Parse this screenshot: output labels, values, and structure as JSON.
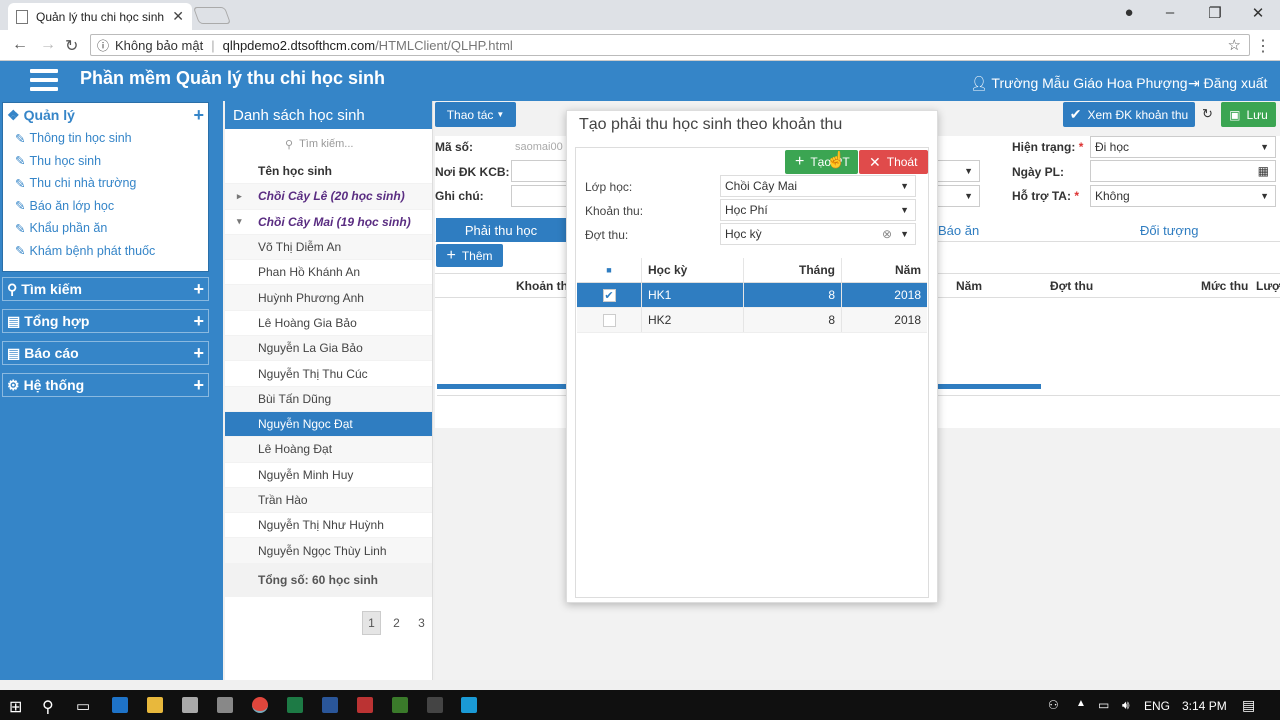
{
  "browser": {
    "tab_title": "Quản lý thu chi học sinh",
    "security_label": "Không bảo mật",
    "url_host": "qlhpdemo2.dtsofthcm.com",
    "url_path": "/HTMLClient/QLHP.html"
  },
  "app": {
    "title": "Phần mềm Quản lý thu chi học sinh",
    "school": "Trường Mẫu Giáo Hoa Phượng",
    "logout": "Đăng xuất"
  },
  "sidebar": {
    "section_manage": "Quản lý",
    "manage_items": [
      "Thông tin học sinh",
      "Thu học sinh",
      "Thu chi nhà trường",
      "Báo ăn lớp học",
      "Khẩu phần ăn",
      "Khám bệnh phát thuốc"
    ],
    "section_search": "Tìm kiếm",
    "section_summary": "Tổng hợp",
    "section_report": "Báo cáo",
    "section_system": "Hệ thống"
  },
  "students": {
    "title": "Danh sách học sinh",
    "search_placeholder": "Tìm kiếm...",
    "col_name": "Tên học sinh",
    "groups": [
      "Chồi Cây Lê (20 học sinh)",
      "Chồi Cây Mai (19 học sinh)"
    ],
    "names": [
      "Võ Thị Diễm An",
      "Phan Hồ Khánh An",
      "Huỳnh Phương Anh",
      "Lê Hoàng Gia Bảo",
      "Nguyễn La Gia Bảo",
      "Nguyễn Thị Thu Cúc",
      "Bùi Tấn Dũng",
      "Nguyễn Ngọc Đạt",
      "Lê Hoàng Đạt",
      "Nguyễn Minh Huy",
      "Trần Hào",
      "Nguyễn Thị Như Huỳnh",
      "Nguyễn Ngọc Thùy Linh"
    ],
    "total": "Tổng số: 60 học sinh",
    "pages": [
      "1",
      "2",
      "3"
    ]
  },
  "main": {
    "actions": "Thao tác",
    "view_btn": "Xem ĐK khoản thu",
    "save_btn": "Lưu",
    "label_id": "Mã số:",
    "id_value": "saomai00",
    "label_kcb": "Nơi ĐK KCB:",
    "label_note": "Ghi chú:",
    "label_status": "Hiện trạng:",
    "status_value": "Đi học",
    "label_date": "Ngày PL:",
    "label_support": "Hỗ trợ TA:",
    "support_value": "Không",
    "tab_receivable": "Phải thu học",
    "tab_meal": "Báo ăn",
    "tab_subject": "Đối tượng",
    "add_btn": "Thêm",
    "col_khoanthu": "Khoản th",
    "col_nam": "Năm",
    "col_dotthu": "Đợt thu",
    "col_mucthu": "Mức thu",
    "col_luot": "Lượ"
  },
  "dialog": {
    "title": "Tạo phải thu học sinh theo khoản thu",
    "btn_create": "Tạo PT",
    "btn_exit": "Thoát",
    "label_class": "Lớp học:",
    "class_value": "Chồi Cây Mai",
    "label_fee": "Khoản thu:",
    "fee_value": "Học Phí",
    "label_period": "Đợt thu:",
    "period_value": "Học kỳ",
    "grid_headers": [
      "Học kỳ",
      "Tháng",
      "Năm"
    ],
    "grid_rows": [
      {
        "hk": "HK1",
        "thang": "8",
        "nam": "2018",
        "checked": true
      },
      {
        "hk": "HK2",
        "thang": "8",
        "nam": "2018",
        "checked": false
      }
    ]
  },
  "taskbar": {
    "lang": "ENG",
    "time": "3:14 PM"
  }
}
